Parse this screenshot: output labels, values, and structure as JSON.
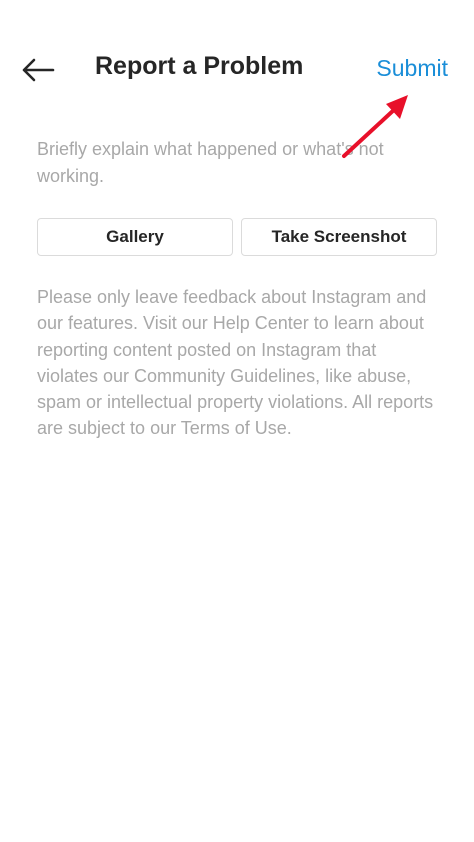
{
  "header": {
    "back_icon": "arrow-left-icon",
    "title": "Report a Problem",
    "submit_label": "Submit"
  },
  "form": {
    "placeholder": "Briefly explain what happened or what's not working."
  },
  "buttons": {
    "gallery_label": "Gallery",
    "screenshot_label": "Take Screenshot"
  },
  "notice": {
    "text": "Please only leave feedback about Instagram and our features. Visit our Help Center to learn about reporting content posted on Instagram that violates our Community Guidelines, like abuse, spam or intellectual property violations. All reports are subject to our Terms of Use."
  },
  "colors": {
    "accent": "#1a8ed8",
    "annotation_arrow": "#e8102a",
    "text_primary": "#262626",
    "text_secondary": "#a8a8a8",
    "border": "#dbdbdb"
  },
  "annotation": {
    "icon": "red-arrow-pointer-icon"
  }
}
